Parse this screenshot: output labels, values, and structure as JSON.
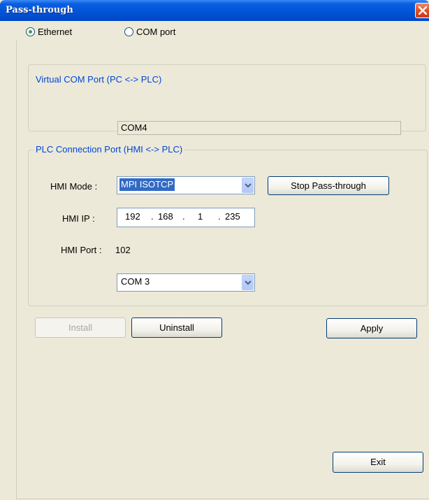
{
  "window": {
    "title": "Pass-through"
  },
  "connection_type": {
    "options": [
      {
        "label": "Ethernet",
        "selected": true
      },
      {
        "label": "COM port",
        "selected": false
      }
    ]
  },
  "virtual_com": {
    "group_title": "Virtual COM Port (PC <-> PLC)",
    "value": "COM4"
  },
  "plc_connection": {
    "group_title": "PLC Connection Port (HMI <-> PLC)",
    "hmi_mode_label": "HMI Mode :",
    "hmi_mode_value": "MPI ISOTCP",
    "stop_button_label": "Stop Pass-through",
    "hmi_ip_label": "HMI IP :",
    "hmi_ip_octets": [
      "192",
      "168",
      "1",
      "235"
    ],
    "ip_separator": ".",
    "hmi_port_label": "HMI Port :",
    "hmi_port_value": "102",
    "com_select_value": "COM 3"
  },
  "buttons": {
    "install": "Install",
    "uninstall": "Uninstall",
    "apply": "Apply",
    "exit": "Exit"
  },
  "colors": {
    "title_bar": "#0254d8",
    "group_title": "#0046d5",
    "selection": "#316ac5",
    "dialog_bg": "#ece9d8"
  },
  "icons": {
    "close": "close-icon",
    "dropdown": "chevron-down-icon",
    "radio": "radio-dot-icon"
  }
}
